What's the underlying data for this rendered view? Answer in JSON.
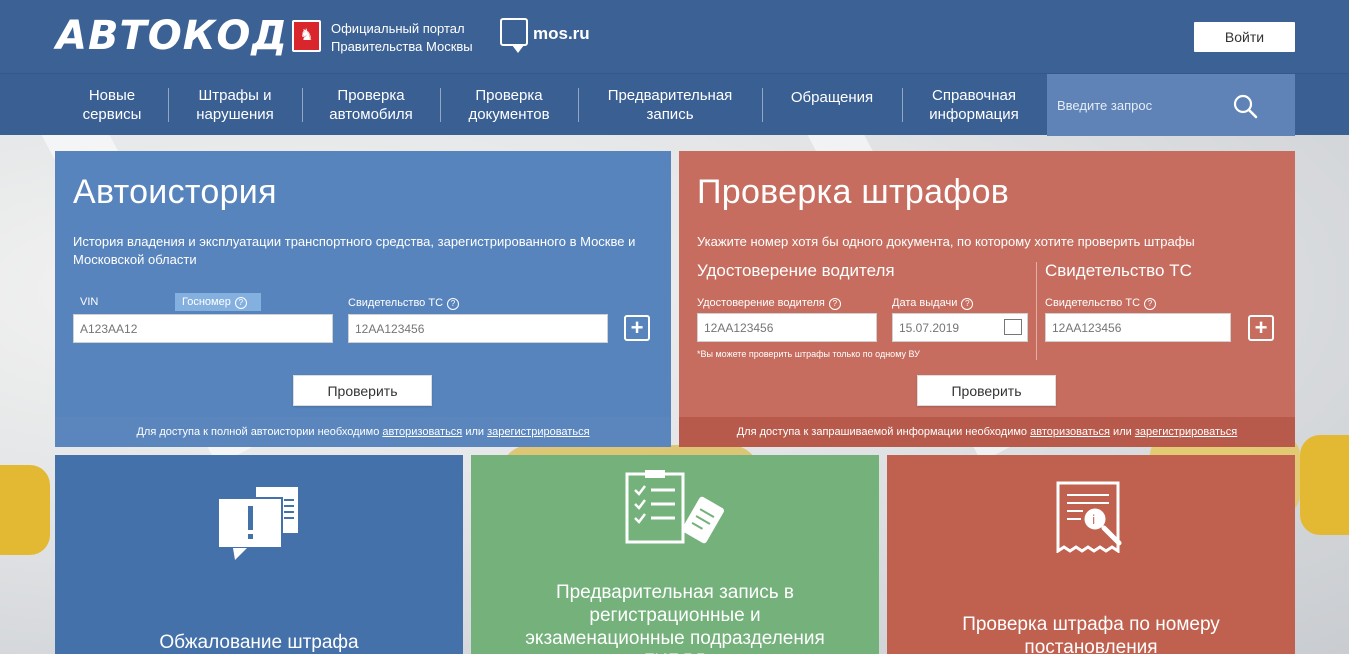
{
  "header": {
    "logo": "АВТОКОД",
    "portal_line1": "Официальный портал",
    "portal_line2": "Правительства Москвы",
    "mos_label": "mos.ru",
    "login_label": "Войти"
  },
  "nav": {
    "items": [
      {
        "label": "Новые\nсервисы"
      },
      {
        "label": "Штрафы и\nнарушения"
      },
      {
        "label": "Проверка\nавтомобиля"
      },
      {
        "label": "Проверка\nдокументов"
      },
      {
        "label": "Предварительная\nзапись"
      },
      {
        "label": "Обращения"
      },
      {
        "label": "Справочная\nинформация"
      }
    ],
    "search_placeholder": "Введите запрос"
  },
  "autohistory": {
    "title": "Автоистория",
    "description": "История владения и эксплуатации транспортного средства, зарегистрированного в Москве и Московской области",
    "vin_label": "VIN",
    "gosnomer_label": "Госномер",
    "field1_placeholder": "А123АА12",
    "svid_label": "Свидетельство ТС",
    "field2_placeholder": "12АА123456",
    "check_label": "Проверить",
    "footer_text": "Для доступа к полной автоистории необходимо",
    "footer_login": "авторизоваться",
    "footer_or": "или",
    "footer_register": "зарегистрироваться"
  },
  "fines": {
    "title": "Проверка штрафов",
    "description": "Укажите номер хотя бы одного документа, по которому хотите проверить штрафы",
    "driver_heading": "Удостоверение водителя",
    "svid_heading": "Свидетельство ТС",
    "driver_label": "Удостоверение водителя",
    "driver_placeholder": "12АА123456",
    "date_label": "Дата выдачи",
    "date_placeholder": "15.07.2019",
    "svid_label": "Свидетельство ТС",
    "svid_placeholder": "12АА123456",
    "note": "*Вы можете проверить штрафы только по одному ВУ",
    "check_label": "Проверить",
    "footer_text": "Для доступа к запрашиваемой информации необходимо",
    "footer_login": "авторизоваться",
    "footer_or": "или",
    "footer_register": "зарегистрироваться"
  },
  "tiles": [
    {
      "label": "Обжалование штрафа",
      "icon": "complaint-icon"
    },
    {
      "label": "Предварительная запись в регистрационные и экзаменационные подразделения ГИБДД",
      "icon": "checklist-icon"
    },
    {
      "label": "Проверка штрафа по номеру постановления",
      "icon": "receipt-search-icon"
    }
  ],
  "colors": {
    "header": "#3c6194",
    "panel_blue": "#5884bd",
    "panel_red": "#c76d5f",
    "tile_blue": "#4471aa",
    "tile_green": "#74b17b",
    "tile_red": "#c0604f"
  }
}
